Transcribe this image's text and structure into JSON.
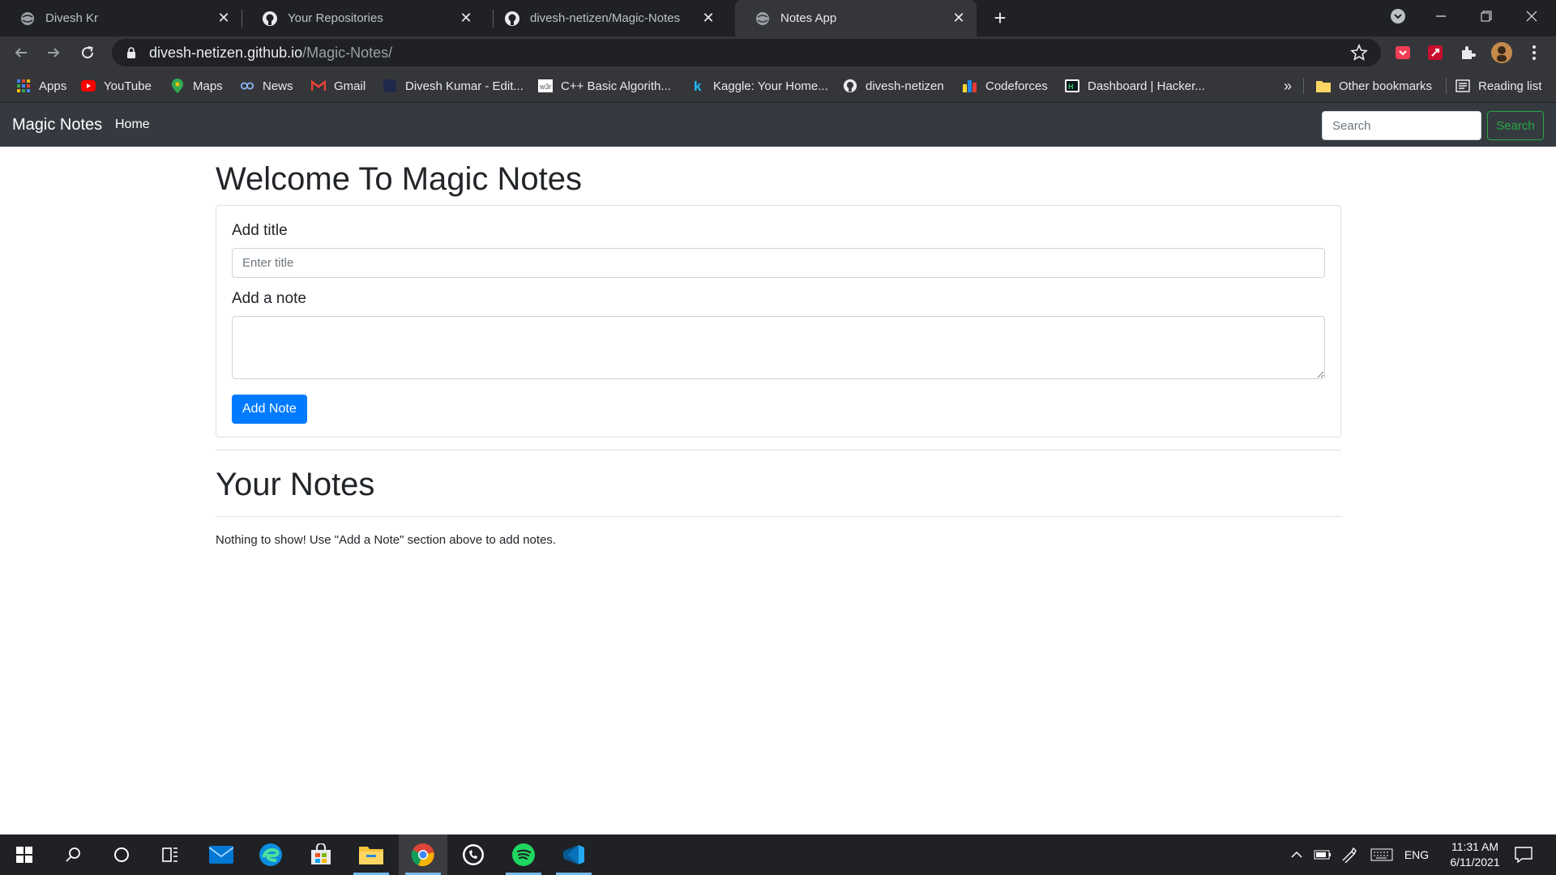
{
  "browser": {
    "tabs": [
      {
        "title": "Divesh Kr",
        "icon": "globe-icon",
        "active": false
      },
      {
        "title": "Your Repositories",
        "icon": "github-icon",
        "active": false
      },
      {
        "title": "divesh-netizen/Magic-Notes",
        "icon": "github-icon",
        "active": false
      },
      {
        "title": "Notes App",
        "icon": "globe-icon",
        "active": true
      }
    ],
    "url_host": "divesh-netizen.github.io",
    "url_path": "/Magic-Notes/",
    "bookmarks": [
      {
        "label": "Apps",
        "icon": "apps-grid-icon"
      },
      {
        "label": "YouTube",
        "icon": "youtube-icon"
      },
      {
        "label": "Maps",
        "icon": "maps-icon"
      },
      {
        "label": "News",
        "icon": "news-icon"
      },
      {
        "label": "Gmail",
        "icon": "gmail-icon"
      },
      {
        "label": "Divesh Kumar - Edit...",
        "icon": "page-icon"
      },
      {
        "label": "C++ Basic Algorith...",
        "icon": "w3-icon"
      },
      {
        "label": "Kaggle: Your Home...",
        "icon": "kaggle-icon"
      },
      {
        "label": "divesh-netizen",
        "icon": "github-icon"
      },
      {
        "label": "Codeforces",
        "icon": "codeforces-icon"
      },
      {
        "label": "Dashboard | Hacker...",
        "icon": "hackerrank-icon"
      }
    ],
    "bookmarks_overflow": "»",
    "other_bookmarks": "Other bookmarks",
    "reading_list": "Reading list"
  },
  "site": {
    "brand": "Magic Notes",
    "nav_home": "Home",
    "search_placeholder": "Search",
    "search_button": "Search"
  },
  "main": {
    "welcome_heading": "Welcome To Magic Notes",
    "title_label": "Add title",
    "title_placeholder": "Enter title",
    "note_label": "Add a note",
    "note_value": "",
    "add_button": "Add Note",
    "notes_heading": "Your Notes",
    "empty_message": "Nothing to show! Use \"Add a Note\" section above to add notes."
  },
  "taskbar": {
    "apps": [
      "windows-start-icon",
      "search-icon",
      "cortana-icon",
      "task-view-icon",
      "mail-icon",
      "edge-icon",
      "store-icon",
      "file-explorer-icon",
      "chrome-icon",
      "whatsapp-icon",
      "spotify-icon",
      "vscode-icon"
    ],
    "language": "ENG",
    "time": "11:31 AM",
    "date": "6/11/2021"
  },
  "colors": {
    "navbar_bg": "#343a40",
    "primary_button": "#007bff",
    "search_button": "#28a745",
    "chrome_dark": "#202124",
    "chrome_toolbar": "#35363a"
  }
}
